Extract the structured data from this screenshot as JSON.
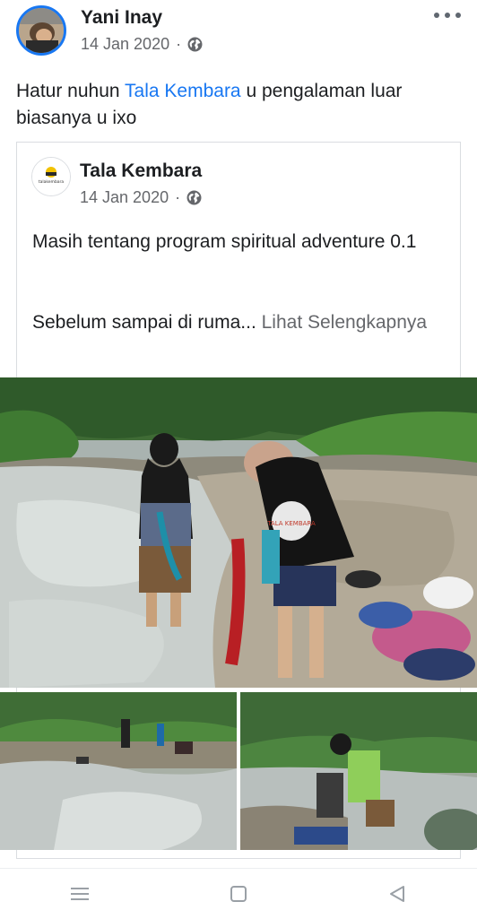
{
  "post": {
    "author": "Yani Inay",
    "date": "14 Jan 2020",
    "separator": "·",
    "text_before": "Hatur nuhun ",
    "mention": "Tala Kembara",
    "text_after": " u pengalaman luar biasanya u ixo"
  },
  "shared": {
    "page_name": "Tala Kembara",
    "avatar_text": "talakembara",
    "date": "14 Jan 2020",
    "separator": "·",
    "line1": "Masih tentang program spiritual adventure 0.1",
    "line2": "Sebelum sampai di ruma... ",
    "see_more": "Lihat Selengkapnya"
  },
  "photos": {
    "main_shirt_text": "TALA KEMBARA"
  },
  "icons": {
    "more": "more-horizontal-icon",
    "privacy": "globe-icon",
    "nav_menu": "menu-icon",
    "nav_home": "square-home-icon",
    "nav_back": "triangle-back-icon"
  },
  "colors": {
    "accent": "#1877f2",
    "meta": "#65676b",
    "text": "#1c1e21"
  }
}
